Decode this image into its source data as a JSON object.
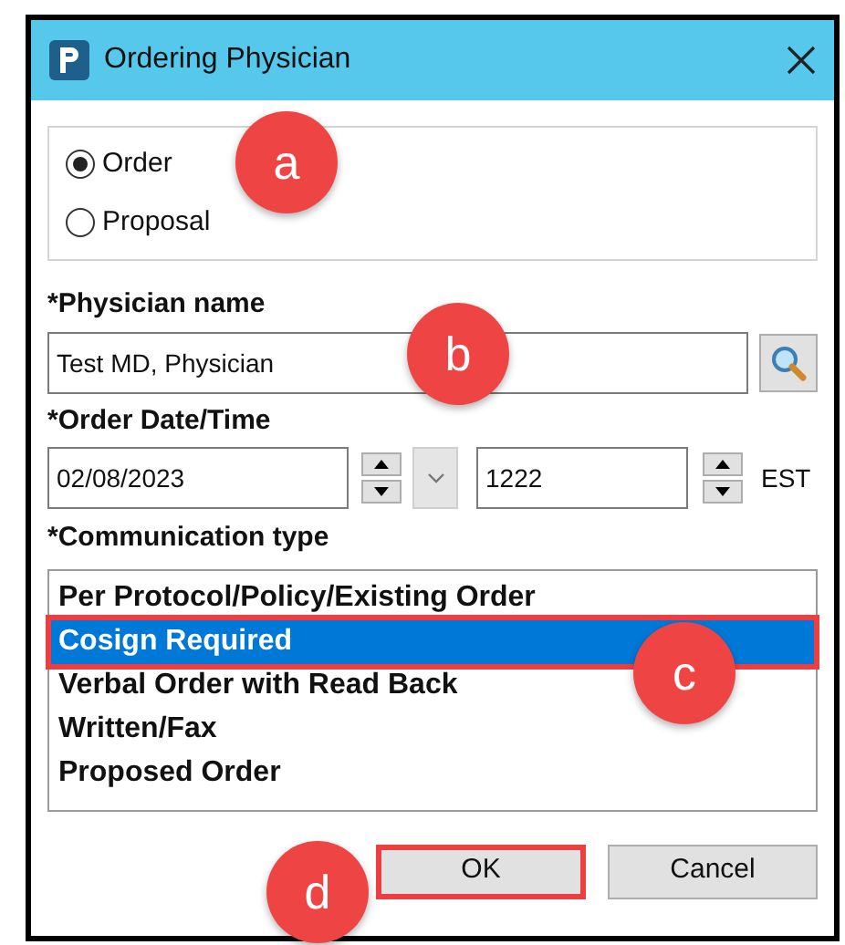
{
  "window": {
    "title": "Ordering Physician"
  },
  "order_type": [
    {
      "label": "Order",
      "selected": true
    },
    {
      "label": "Proposal",
      "selected": false
    }
  ],
  "physician": {
    "label": "*Physician name",
    "value": "Test MD, Physician"
  },
  "order_datetime": {
    "label": "*Order Date/Time",
    "date": "02/08/2023",
    "time": "1222",
    "timezone": "EST"
  },
  "communication": {
    "label": "*Communication type",
    "options": [
      {
        "label": "Per Protocol/Policy/Existing Order",
        "selected": false,
        "highlighted": false
      },
      {
        "label": "Cosign Required",
        "selected": true,
        "highlighted": true
      },
      {
        "label": "Verbal Order with Read Back",
        "selected": false,
        "highlighted": false
      },
      {
        "label": "Written/Fax",
        "selected": false,
        "highlighted": false
      },
      {
        "label": "Proposed Order",
        "selected": false,
        "highlighted": false
      }
    ]
  },
  "buttons": [
    {
      "label": "OK",
      "highlighted": true
    },
    {
      "label": "Cancel",
      "highlighted": false
    }
  ],
  "callouts": [
    {
      "label": "a"
    },
    {
      "label": "b"
    },
    {
      "label": "c"
    },
    {
      "label": "d"
    }
  ]
}
